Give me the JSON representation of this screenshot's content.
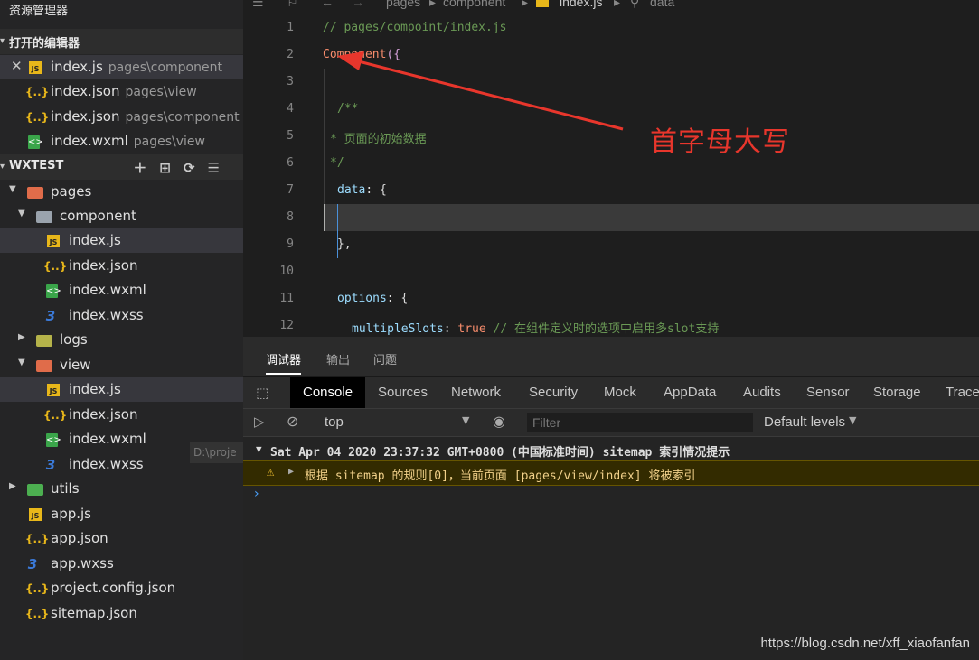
{
  "sidebar": {
    "title": "资源管理器",
    "open_editors_header": "打开的编辑器",
    "open_editors": [
      {
        "name": "index.js",
        "path": "pages\\component",
        "icon": "js-file-icon",
        "close": "✕"
      },
      {
        "name": "index.json",
        "path": "pages\\view",
        "icon": "json-file-icon"
      },
      {
        "name": "index.json",
        "path": "pages\\component",
        "icon": "json-file-icon"
      },
      {
        "name": "index.wxml",
        "path": "pages\\view",
        "icon": "wxml-file-icon"
      }
    ],
    "project_header": "WXTEST",
    "tree": {
      "pages": "pages",
      "component": "component",
      "comp_js": "index.js",
      "comp_json": "index.json",
      "comp_wxml": "index.wxml",
      "comp_wxss": "index.wxss",
      "logs": "logs",
      "view": "view",
      "view_js": "index.js",
      "view_json": "index.json",
      "view_wxml": "index.wxml",
      "view_wxss": "index.wxss",
      "utils": "utils",
      "app_js": "app.js",
      "app_json": "app.json",
      "app_wxss": "app.wxss",
      "project_config": "project.config.json",
      "sitemap": "sitemap.json"
    },
    "tooltip": "D:\\proje"
  },
  "editor": {
    "breadcrumb": [
      "pages",
      "component",
      "index.js",
      "data"
    ],
    "line_numbers": [
      "1",
      "2",
      "3",
      "4",
      "5",
      "6",
      "7",
      "8",
      "9",
      "10",
      "11",
      "12"
    ],
    "lines": {
      "l1": "// pages/compoint/index.js",
      "l2_fn": "Component",
      "l2_paren": "({",
      "l4": "/**",
      "l5": "* 页面的初始数据",
      "l6": "*/",
      "l7_key": "data",
      "l7_rest": ": {",
      "l9": "},",
      "l11_key": "options",
      "l11_rest": ": {",
      "l12_key": "multipleSlots",
      "l12_colon": ": ",
      "l12_val": "true",
      "l12_comment": " // 在组件定义时的选项中启用多slot支持"
    },
    "annotation": "首字母大写"
  },
  "devtools": {
    "top_tabs": [
      "调试器",
      "输出",
      "问题"
    ],
    "panel_tabs": [
      "Console",
      "Sources",
      "Network",
      "Security",
      "Mock",
      "AppData",
      "Audits",
      "Sensor",
      "Storage",
      "Trace"
    ],
    "context": "top",
    "filter_placeholder": "Filter",
    "levels": "Default levels",
    "group_line": "Sat Apr 04 2020 23:37:32 GMT+0800 (中国标准时间) sitemap 索引情况提示",
    "warning_line": "根据 sitemap 的规则[0]，当前页面 [pages/view/index] 将被索引"
  },
  "watermark": "https://blog.csdn.net/xff_xiaofanfan",
  "colors": {
    "annotation": "#e8362c",
    "keyword": "#f78c6c",
    "comment": "#6a9955",
    "warning_bg": "#332b00"
  }
}
